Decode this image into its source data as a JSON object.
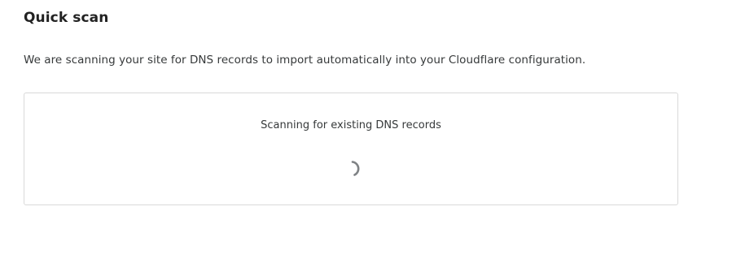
{
  "quick_scan": {
    "title": "Quick scan",
    "description": "We are scanning your site for DNS records to import automatically into your Cloudflare configuration.",
    "status_text": "Scanning for existing DNS records",
    "spinner_icon": "loading-spinner-icon"
  },
  "colors": {
    "spinner": "#7f8285",
    "border": "#d9d9d9",
    "text": "#36393a"
  }
}
